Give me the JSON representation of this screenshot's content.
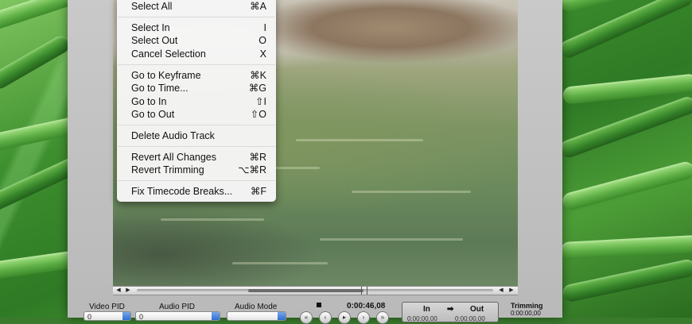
{
  "menu": {
    "items": [
      {
        "label": "Select All",
        "shortcut": "⌘A"
      },
      {
        "label": "Select In",
        "shortcut": "I"
      },
      {
        "label": "Select Out",
        "shortcut": "O"
      },
      {
        "label": "Cancel Selection",
        "shortcut": "X"
      },
      {
        "label": "Go to Keyframe",
        "shortcut": "⌘K"
      },
      {
        "label": "Go to Time...",
        "shortcut": "⌘G"
      },
      {
        "label": "Go to In",
        "shortcut": "⇧I"
      },
      {
        "label": "Go to Out",
        "shortcut": "⇧O"
      },
      {
        "label": "Delete Audio Track",
        "shortcut": ""
      },
      {
        "label": "Revert All Changes",
        "shortcut": "⌘R"
      },
      {
        "label": "Revert Trimming",
        "shortcut": "⌥⌘R"
      },
      {
        "label": "Fix Timecode Breaks...",
        "shortcut": "⌘F"
      }
    ]
  },
  "controls": {
    "video_pid_label": "Video PID",
    "video_pid_value": "0",
    "audio_pid_label": "Audio PID",
    "audio_pid_value": "0",
    "audio_mode_label": "Audio Mode",
    "current_time": "0:00:46,08",
    "in_label": "In",
    "in_out_arrow": "➡",
    "out_label": "Out",
    "in_value": "0:00:00,00",
    "out_value": "0:00:00,00",
    "trimming_label": "Trimming",
    "trimming_value": "0:00:00,00"
  },
  "icons": {
    "stop": "stop-icon",
    "rewind": "rewind-icon",
    "step_back": "step-back-icon",
    "play": "play-icon",
    "step_forward": "step-forward-icon",
    "fast_forward": "fast-forward-icon"
  },
  "colors": {
    "menu_bg": "#f6f6f6",
    "window_bg": "#c0c0c0",
    "popup_arrow": "#2f6fd0"
  }
}
